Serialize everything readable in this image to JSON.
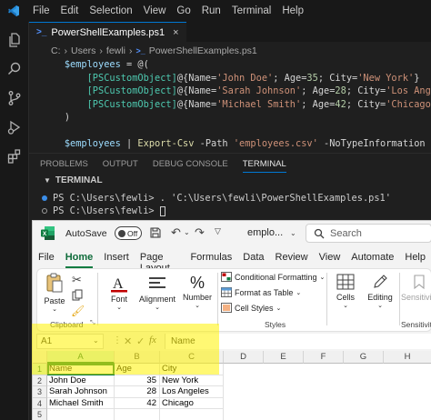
{
  "vscode": {
    "menu": [
      "File",
      "Edit",
      "Selection",
      "View",
      "Go",
      "Run",
      "Terminal",
      "Help"
    ],
    "tab_label": "PowerShellExamples.ps1",
    "breadcrumb": [
      "C:",
      "Users",
      "fewli",
      "PowerShellExamples.ps1"
    ],
    "code": {
      "l1": {
        "var": "$employees",
        "rest": " = @("
      },
      "l2": {
        "type": "[PSCustomObject]",
        "a": "@{Name=",
        "s1": "'John Doe'",
        "b": "; Age=",
        "n": "35",
        "c": "; City=",
        "s2": "'New York'",
        "d": "}"
      },
      "l3": {
        "type": "[PSCustomObject]",
        "a": "@{Name=",
        "s1": "'Sarah Johnson'",
        "b": "; Age=",
        "n": "28",
        "c": "; City=",
        "s2": "'Los Angeles'",
        "d": "}"
      },
      "l4": {
        "type": "[PSCustomObject]",
        "a": "@{Name=",
        "s1": "'Michael Smith'",
        "b": "; Age=",
        "n": "42",
        "c": "; City=",
        "s2": "'Chicago'",
        "d": "}"
      },
      "l5": ")",
      "l7": {
        "var": "$employees",
        "pipe": " | ",
        "cmd": "Export-Csv",
        "p1": " -Path ",
        "s": "'employees.csv'",
        "p2": " -NoTypeInformation"
      }
    },
    "panel_tabs": [
      "PROBLEMS",
      "OUTPUT",
      "DEBUG CONSOLE",
      "TERMINAL"
    ],
    "terminal_header": "TERMINAL",
    "terminal_lines": [
      "PS C:\\Users\\fewli> . 'C:\\Users\\fewli\\PowerShellExamples.ps1'",
      "PS C:\\Users\\fewli> "
    ]
  },
  "excel": {
    "autosave_label": "AutoSave",
    "autosave_state": "Off",
    "filename": "emplo...",
    "search_placeholder": "Search",
    "tabs": [
      "File",
      "Home",
      "Insert",
      "Page Layout",
      "Formulas",
      "Data",
      "Review",
      "View",
      "Automate",
      "Help"
    ],
    "ribbon": {
      "paste": "Paste",
      "clipboard": "Clipboard",
      "font": "Font",
      "alignment": "Alignment",
      "number": "Number",
      "conditional_formatting": "Conditional Formatting",
      "format_as_table": "Format as Table",
      "cell_styles": "Cell Styles",
      "styles": "Styles",
      "cells": "Cells",
      "editing": "Editing",
      "sensitivity": "Sensitivity",
      "sensitivity_group": "Sensitivity"
    },
    "name_box": "A1",
    "formula_value": "Name",
    "columns": [
      "A",
      "B",
      "C",
      "D",
      "E",
      "F",
      "G",
      "H"
    ],
    "rows": [
      "1",
      "2",
      "3",
      "4",
      "5"
    ],
    "cells": [
      [
        "Name",
        "Age",
        "City"
      ],
      [
        "John Doe",
        "35",
        "New York"
      ],
      [
        "Sarah Johnson",
        "28",
        "Los Angeles"
      ],
      [
        "Michael Smith",
        "42",
        "Chicago"
      ],
      [
        "",
        "",
        ""
      ]
    ],
    "colors": {
      "brand": "#107c41",
      "highlight": "#fff200"
    }
  }
}
